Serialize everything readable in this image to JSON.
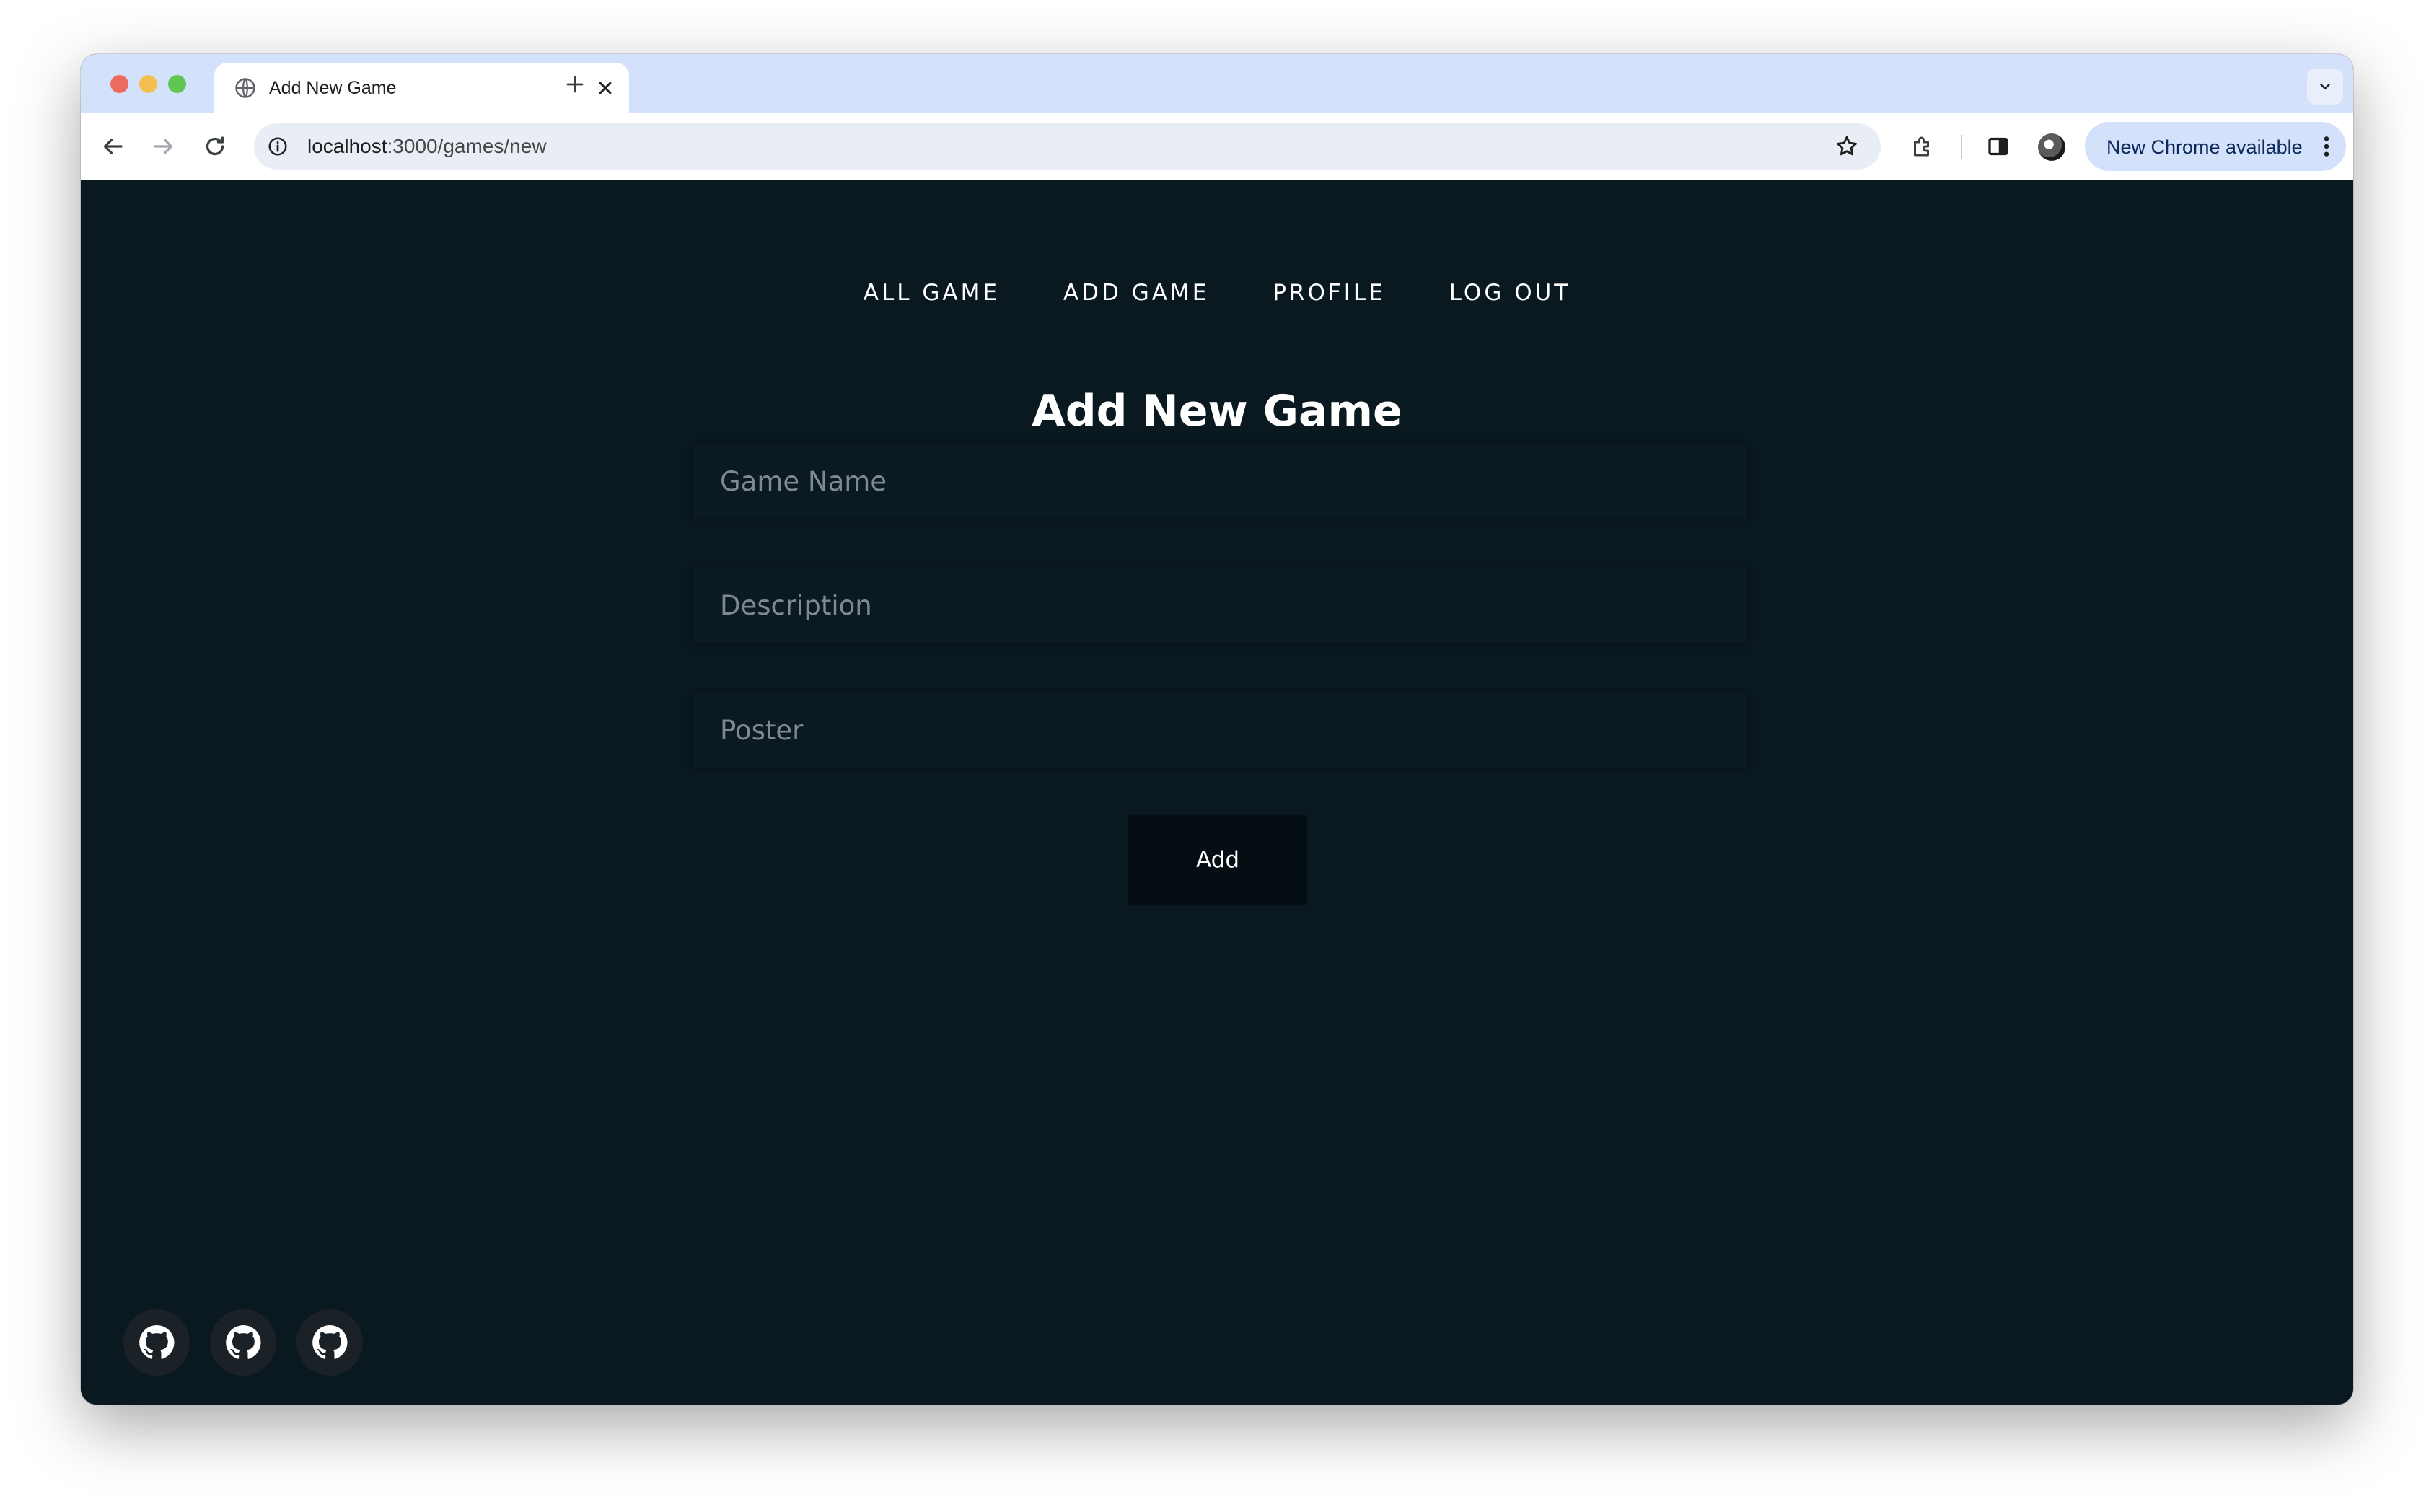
{
  "browser": {
    "tab_title": "Add New Game",
    "url_host": "localhost",
    "url_path": ":3000/games/new",
    "update_pill": "New Chrome available"
  },
  "nav": {
    "items": [
      {
        "label": "ALL GAME"
      },
      {
        "label": "ADD GAME"
      },
      {
        "label": "PROFILE"
      },
      {
        "label": "LOG OUT"
      }
    ]
  },
  "form": {
    "title": "Add New Game",
    "fields": [
      {
        "placeholder": "Game Name",
        "value": ""
      },
      {
        "placeholder": "Description",
        "value": ""
      },
      {
        "placeholder": "Poster",
        "value": ""
      }
    ],
    "submit_label": "Add"
  },
  "footer": {
    "icons": [
      "github-icon",
      "github-icon",
      "github-icon"
    ]
  },
  "colors": {
    "page_bg": "#0a1820",
    "button_bg": "#050e13",
    "tabstrip_bg": "#d4e1fa"
  }
}
